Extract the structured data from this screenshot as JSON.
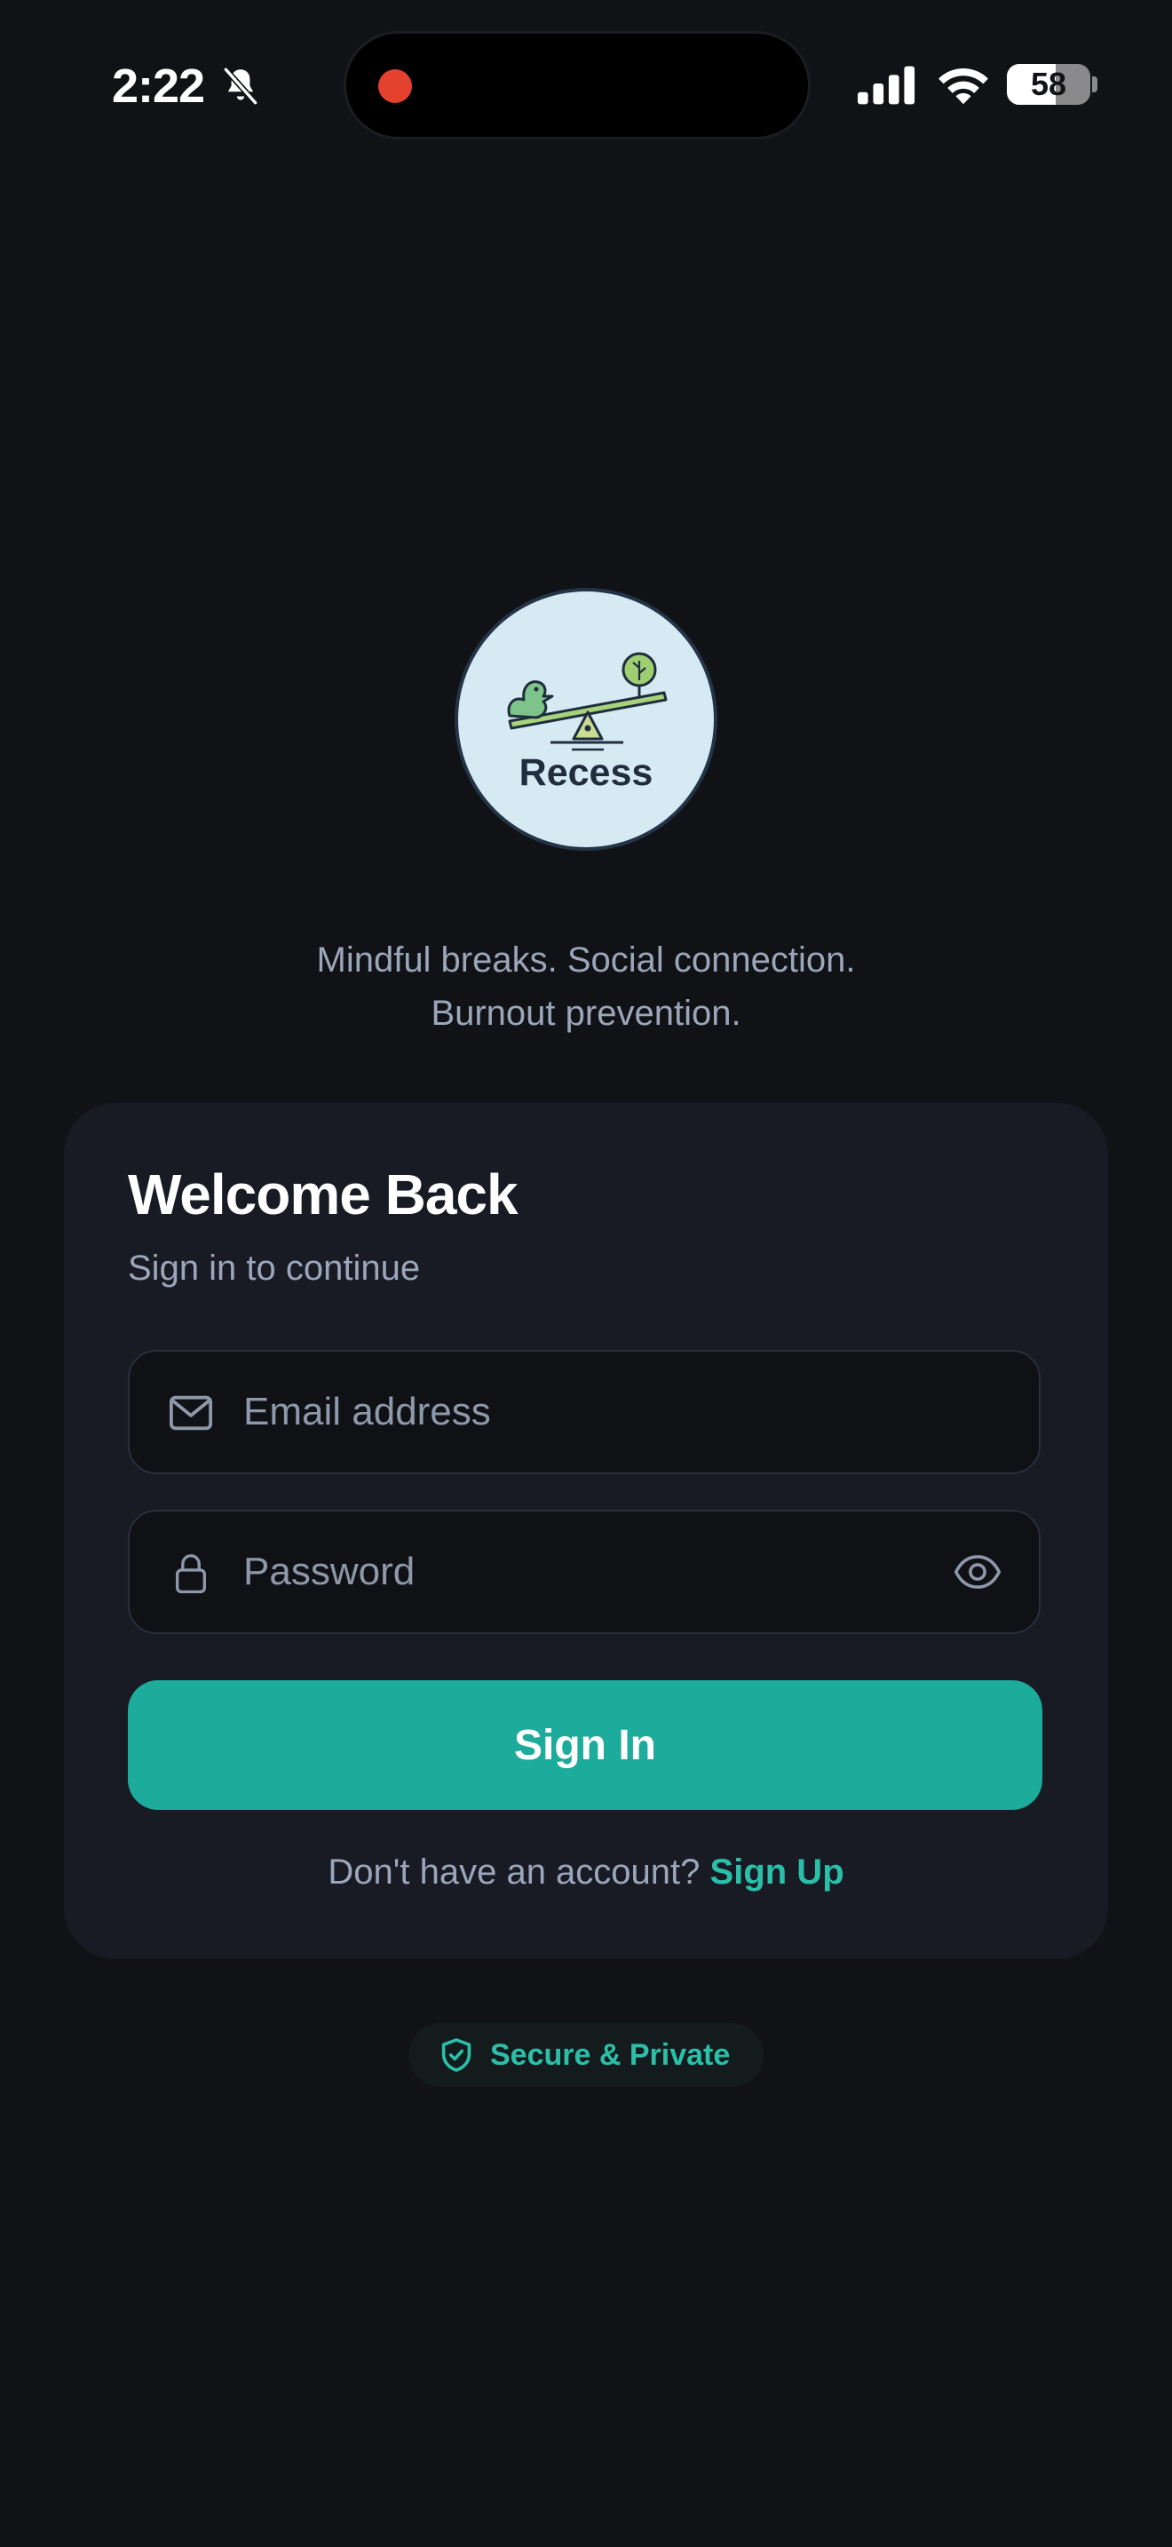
{
  "status_bar": {
    "time": "2:22",
    "battery_level": "58",
    "battery_fraction": 0.58,
    "recording_color": "#e5412f"
  },
  "logo": {
    "text": "Recess"
  },
  "tagline": {
    "line1": "Mindful breaks. Social connection.",
    "line2": "Burnout prevention."
  },
  "login_card": {
    "title": "Welcome Back",
    "subtitle": "Sign in to continue",
    "email_placeholder": "Email address",
    "password_placeholder": "Password",
    "signin_label": "Sign In",
    "signup_prompt": "Don't have an account?",
    "signup_link": "Sign Up"
  },
  "badge": {
    "text": "Secure & Private"
  },
  "colors": {
    "background": "#111216",
    "card": "#181b24",
    "accent": "#1dab9b",
    "accent_text": "#2bbfa9",
    "muted_text": "#9ba6ba"
  },
  "icons": [
    "bell-off-icon",
    "signal-icon",
    "wifi-icon",
    "battery-icon",
    "mail-icon",
    "lock-icon",
    "eye-icon",
    "shield-check-icon"
  ]
}
